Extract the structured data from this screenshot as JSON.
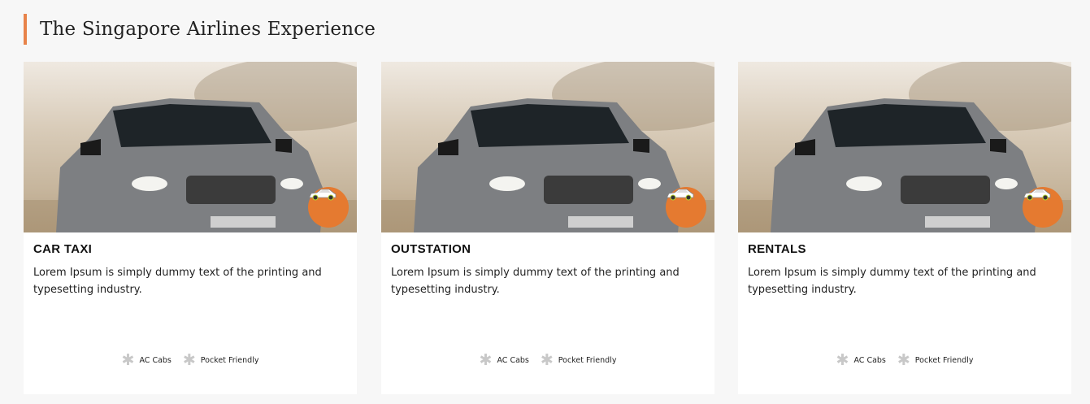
{
  "page": {
    "title": "The Singapore Airlines Experience",
    "accent_color": "#e8834a"
  },
  "cards": [
    {
      "title": "CAR TAXI",
      "description": "Lorem Ipsum is simply dummy text of the printing and typesetting industry.",
      "badge_icon": "car-icon",
      "features": [
        "AC Cabs",
        "Pocket Friendly"
      ]
    },
    {
      "title": "OUTSTATION",
      "description": "Lorem Ipsum is simply dummy text of the printing and typesetting industry.",
      "badge_icon": "car-icon",
      "features": [
        "AC Cabs",
        "Pocket Friendly"
      ]
    },
    {
      "title": "RENTALS",
      "description": "Lorem Ipsum is simply dummy text of the printing and typesetting industry.",
      "badge_icon": "car-icon",
      "features": [
        "AC Cabs",
        "Pocket Friendly"
      ]
    }
  ],
  "badge_color": "#e57a30"
}
